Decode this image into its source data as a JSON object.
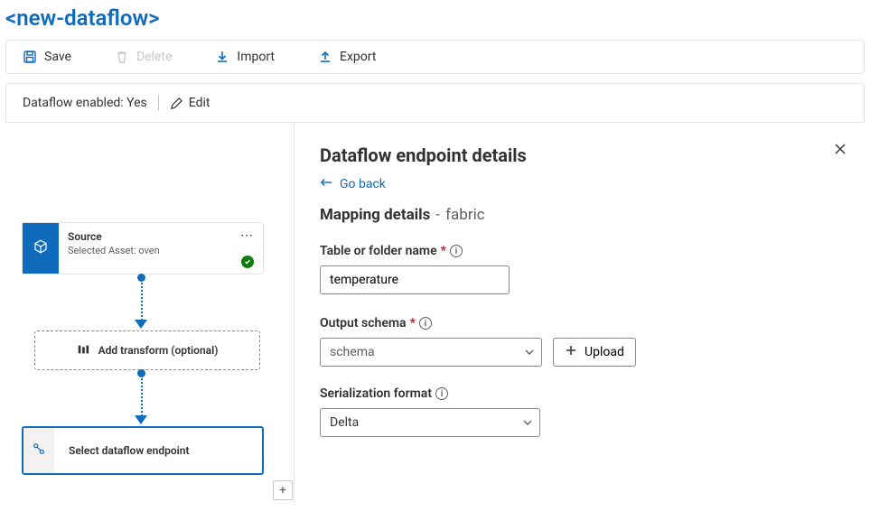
{
  "page_title": "<new-dataflow>",
  "toolbar": {
    "save_label": "Save",
    "delete_label": "Delete",
    "import_label": "Import",
    "export_label": "Export"
  },
  "status": {
    "enabled_text": "Dataflow enabled: Yes",
    "edit_label": "Edit"
  },
  "flow": {
    "source": {
      "title": "Source",
      "subtitle": "Selected Asset: oven"
    },
    "transform_label": "Add transform (optional)",
    "endpoint_label": "Select dataflow endpoint"
  },
  "panel": {
    "title": "Dataflow endpoint details",
    "go_back": "Go back",
    "mapping_label": "Mapping details",
    "mapping_target": "fabric",
    "fields": {
      "table_label": "Table or folder name",
      "table_value": "temperature",
      "schema_label": "Output schema",
      "schema_placeholder": "schema",
      "upload_label": "Upload",
      "serial_label": "Serialization format",
      "serial_value": "Delta"
    }
  },
  "colors": {
    "accent": "#0f6cbd"
  }
}
